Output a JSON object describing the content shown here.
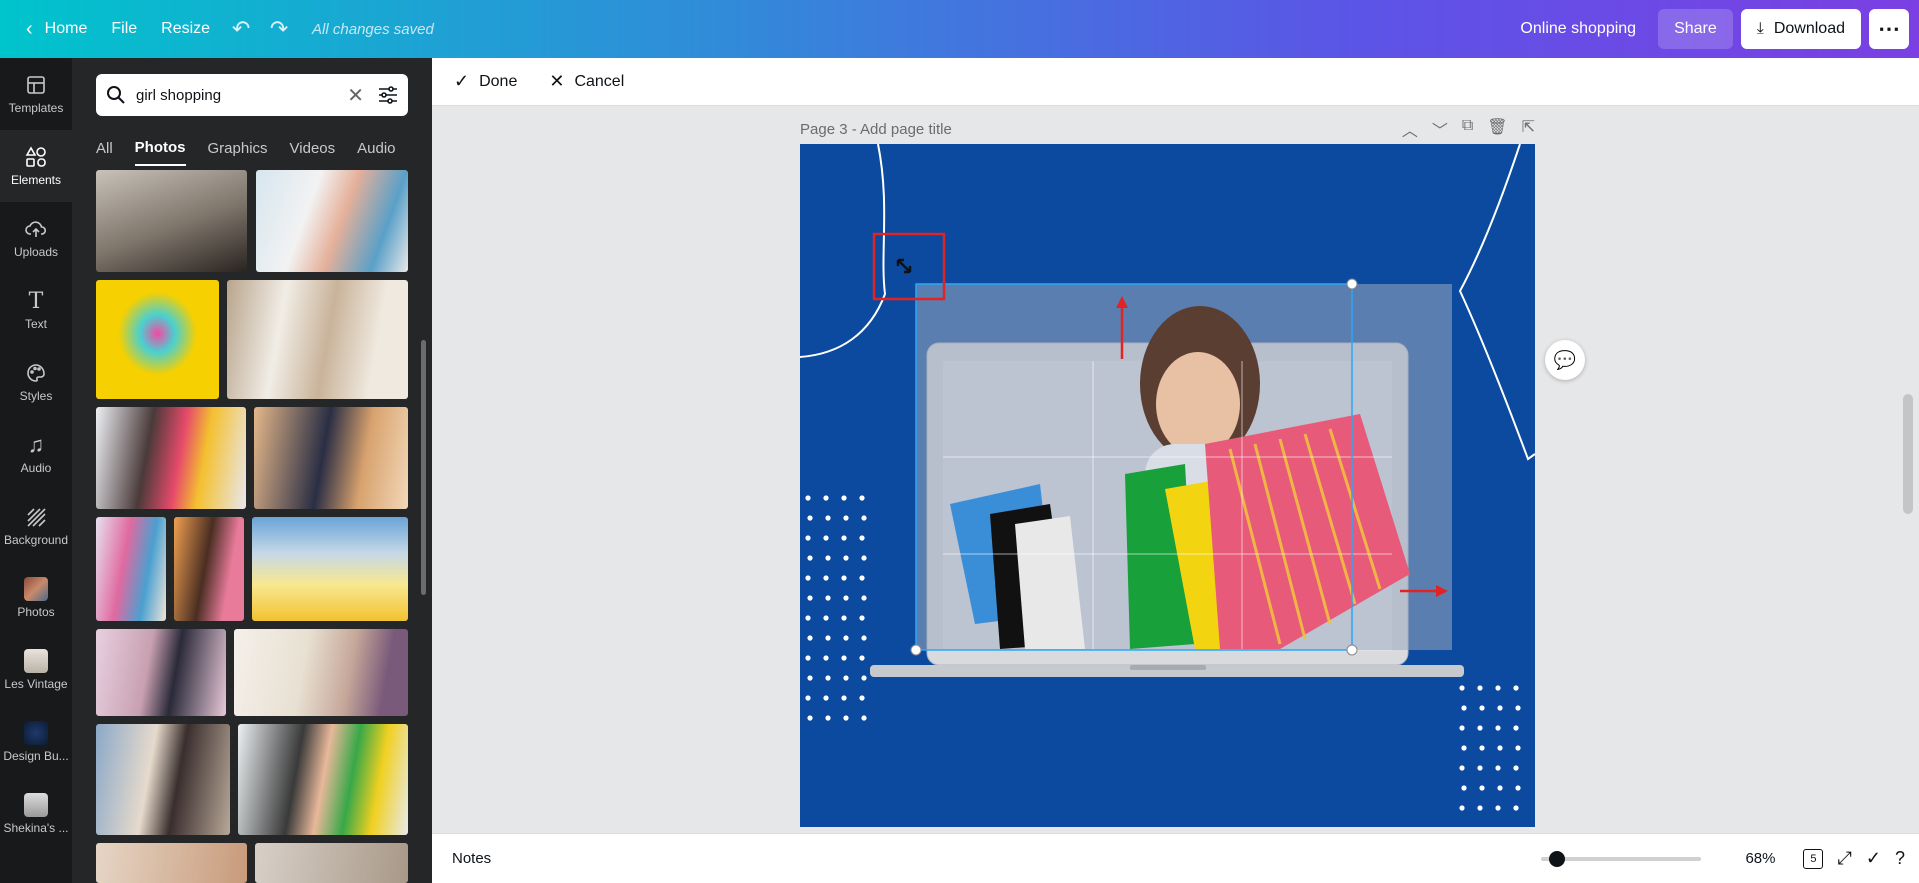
{
  "topbar": {
    "home": "Home",
    "file": "File",
    "resize": "Resize",
    "saved": "All changes saved",
    "design_title": "Online shopping",
    "share": "Share",
    "download": "Download"
  },
  "leftnav": {
    "items": [
      {
        "label": "Templates"
      },
      {
        "label": "Elements"
      },
      {
        "label": "Uploads"
      },
      {
        "label": "Text"
      },
      {
        "label": "Styles"
      },
      {
        "label": "Audio"
      },
      {
        "label": "Background"
      },
      {
        "label": "Photos"
      },
      {
        "label": "Les Vintage"
      },
      {
        "label": "Design Bu..."
      },
      {
        "label": "Shekina's ..."
      }
    ]
  },
  "panel": {
    "search_value": "girl shopping",
    "tabs": [
      "All",
      "Photos",
      "Graphics",
      "Videos",
      "Audio"
    ]
  },
  "editor": {
    "done": "Done",
    "cancel": "Cancel",
    "page_title": "Page 3 - Add page title",
    "notes": "Notes",
    "zoom": "68%",
    "page_count": "5"
  },
  "colors": {
    "canvas_bg": "#0b4a9f",
    "selection": "#2aa7f5",
    "highlight": "#e02424"
  }
}
